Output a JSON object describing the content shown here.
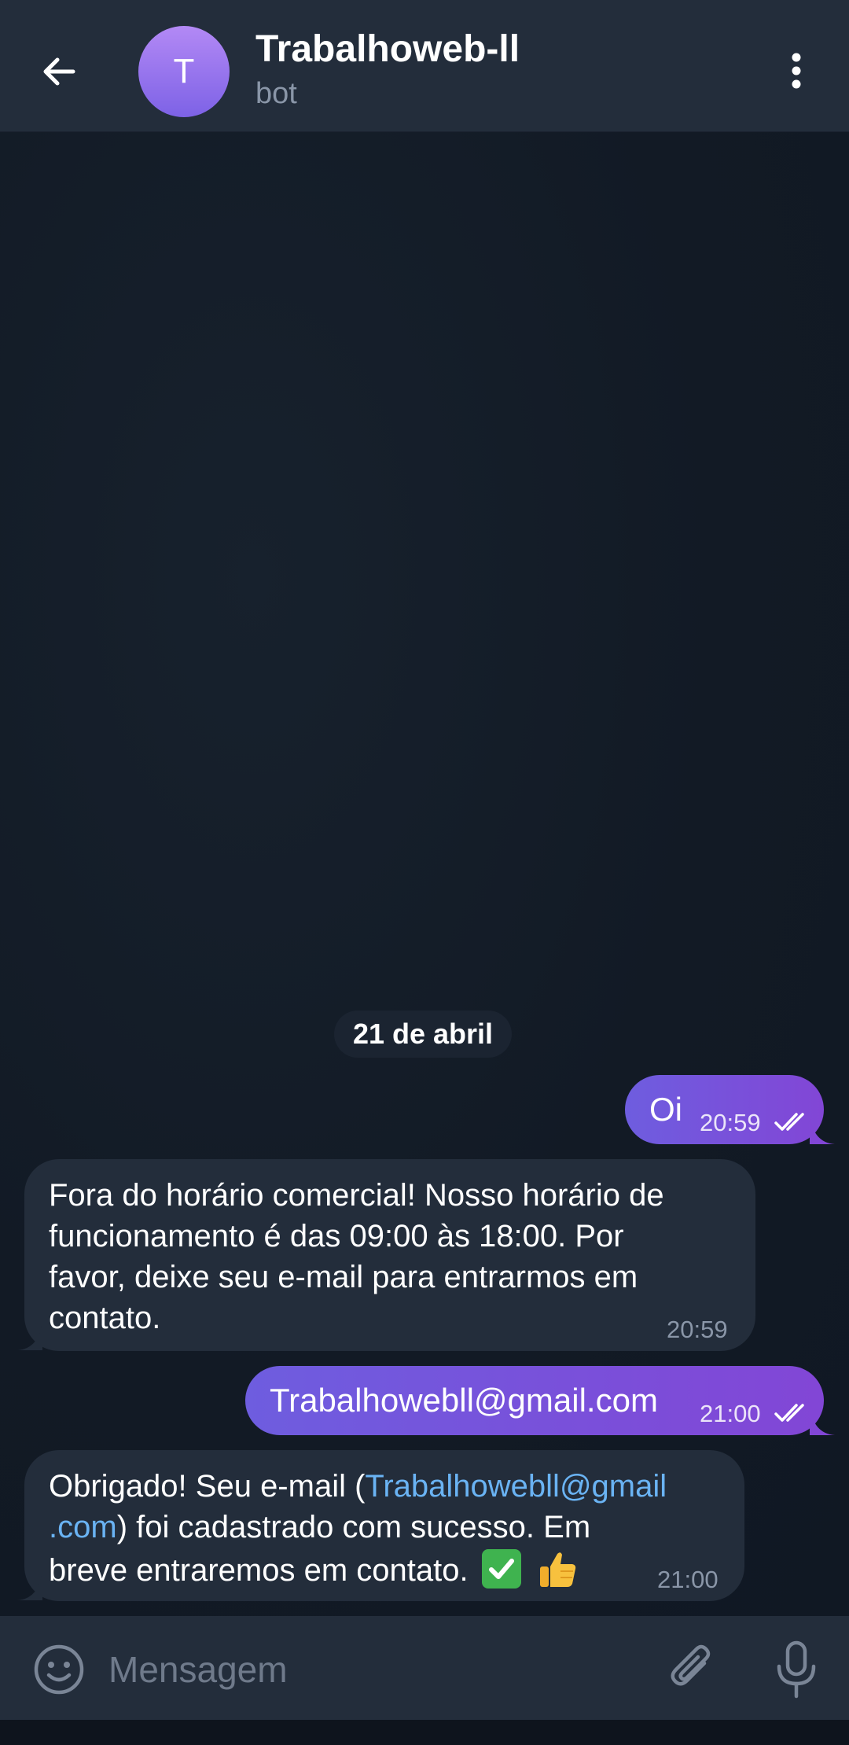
{
  "header": {
    "title": "Trabalhoweb-ll",
    "subtitle": "bot",
    "avatar_letter": "T",
    "icons": [
      "back-arrow-icon",
      "more-vertical-icon"
    ]
  },
  "chat": {
    "date_label": "21 de abril",
    "messages": [
      {
        "direction": "outgoing",
        "text": "Oi",
        "time": "20:59",
        "status": "read"
      },
      {
        "direction": "incoming",
        "lines": [
          "Fora do horário comercial! Nosso horário de",
          "funcionamento é das 09:00 às 18:00. Por",
          "favor, deixe seu e-mail para entrarmos em",
          "contato."
        ],
        "time": "20:59"
      },
      {
        "direction": "outgoing",
        "text": "Trabalhowebll@gmail.com",
        "time": "21:00",
        "status": "read"
      },
      {
        "direction": "incoming",
        "line1_prefix": "Obrigado! Seu e-mail (",
        "link_part1": "Trabalhowebll@gmail",
        "link_part2": ".com",
        "line2_suffix": ") foi cadastrado com sucesso. Em",
        "line3": "breve entraremos em contato.",
        "emojis": [
          "check-mark-button-emoji",
          "thumbs-up-emoji"
        ],
        "time": "21:00"
      }
    ]
  },
  "composer": {
    "placeholder": "Mensagem",
    "icons": [
      "emoji-icon",
      "attach-icon",
      "microphone-icon"
    ]
  },
  "colors": {
    "header_bg": "#232d3b",
    "chat_bg": "#111925",
    "outgoing_bubble": "#7a52db",
    "incoming_bubble": "#232d3b",
    "link": "#6ab3f3",
    "muted_text": "#8a96a8"
  }
}
